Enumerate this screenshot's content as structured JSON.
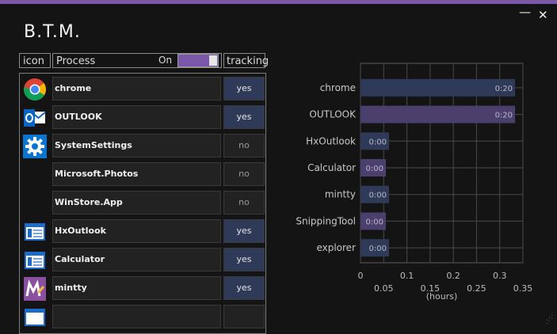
{
  "window": {
    "title": "B.T.M.",
    "minimize_glyph": "—",
    "close_glyph": "✕",
    "accent_color": "#7a57a8"
  },
  "list_header": {
    "icon_label": "icon",
    "process_label": "Process",
    "toggle_label": "On",
    "toggle_state": true,
    "tracking_label": "tracking"
  },
  "processes": [
    {
      "name": "chrome",
      "tracking": "yes",
      "icon": "chrome-icon"
    },
    {
      "name": "OUTLOOK",
      "tracking": "yes",
      "icon": "outlook-icon"
    },
    {
      "name": "SystemSettings",
      "tracking": "no",
      "icon": "settings-gear-icon"
    },
    {
      "name": "Microsoft.Photos",
      "tracking": "no",
      "icon": ""
    },
    {
      "name": "WinStore.App",
      "tracking": "no",
      "icon": ""
    },
    {
      "name": "HxOutlook",
      "tracking": "yes",
      "icon": "generic-app-window-icon"
    },
    {
      "name": "Calculator",
      "tracking": "yes",
      "icon": "generic-app-window-icon"
    },
    {
      "name": "mintty",
      "tracking": "yes",
      "icon": "mintty-icon"
    },
    {
      "name": "",
      "tracking": "",
      "icon": "generic-app-window-icon"
    }
  ],
  "chart_data": {
    "type": "bar",
    "orientation": "horizontal",
    "categories": [
      "chrome",
      "OUTLOOK",
      "HxOutlook",
      "Calculator",
      "mintty",
      "SnippingTool",
      "explorer"
    ],
    "values": [
      0.333,
      0.333,
      0.0,
      0.0,
      0.0,
      0.0,
      0.0
    ],
    "data_labels": [
      "0:20",
      "0:20",
      "0:00",
      "0:00",
      "0:00",
      "0:00",
      "0:00"
    ],
    "bar_colors": [
      "#2f3a58",
      "#4a3f6d",
      "#2f3a58",
      "#4a3f6d",
      "#2f3a58",
      "#4a3f6d",
      "#2f3a58"
    ],
    "xlabel": "(hours)",
    "xlim": [
      0,
      0.35
    ],
    "xticks": [
      "0",
      "0.05",
      "0.1",
      "0.15",
      "0.2",
      "0.25",
      "0.3",
      "0.35"
    ],
    "grid": true
  }
}
